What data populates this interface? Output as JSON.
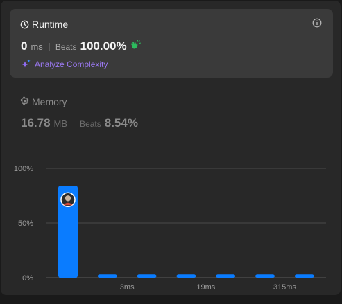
{
  "runtime": {
    "title": "Runtime",
    "value": "0",
    "unit": "ms",
    "beats_label": "Beats",
    "beats_value": "100.00%",
    "analyze_label": "Analyze Complexity"
  },
  "memory": {
    "title": "Memory",
    "value": "16.78",
    "unit": "MB",
    "beats_label": "Beats",
    "beats_value": "8.54%"
  },
  "icons": {
    "runtime": "clock-icon",
    "info": "info-icon",
    "clap": "clapping-hands-icon",
    "analyze": "sparkle-icon",
    "memory": "chip-icon",
    "avatar": "user-avatar"
  },
  "colors": {
    "bar": "#0a7cff",
    "analyze": "#9c79f4",
    "clap": "#2cbb5d"
  },
  "chart_data": {
    "type": "bar",
    "y_ticks": [
      "0%",
      "50%",
      "100%"
    ],
    "ylim": [
      0,
      100
    ],
    "x_tick_labels": [
      {
        "label": "3ms",
        "after_bar": 2
      },
      {
        "label": "19ms",
        "after_bar": 4
      },
      {
        "label": "315ms",
        "after_bar": 6
      }
    ],
    "values": [
      84,
      3,
      3,
      3,
      3,
      3,
      3
    ],
    "highlighted_bar": 0
  }
}
